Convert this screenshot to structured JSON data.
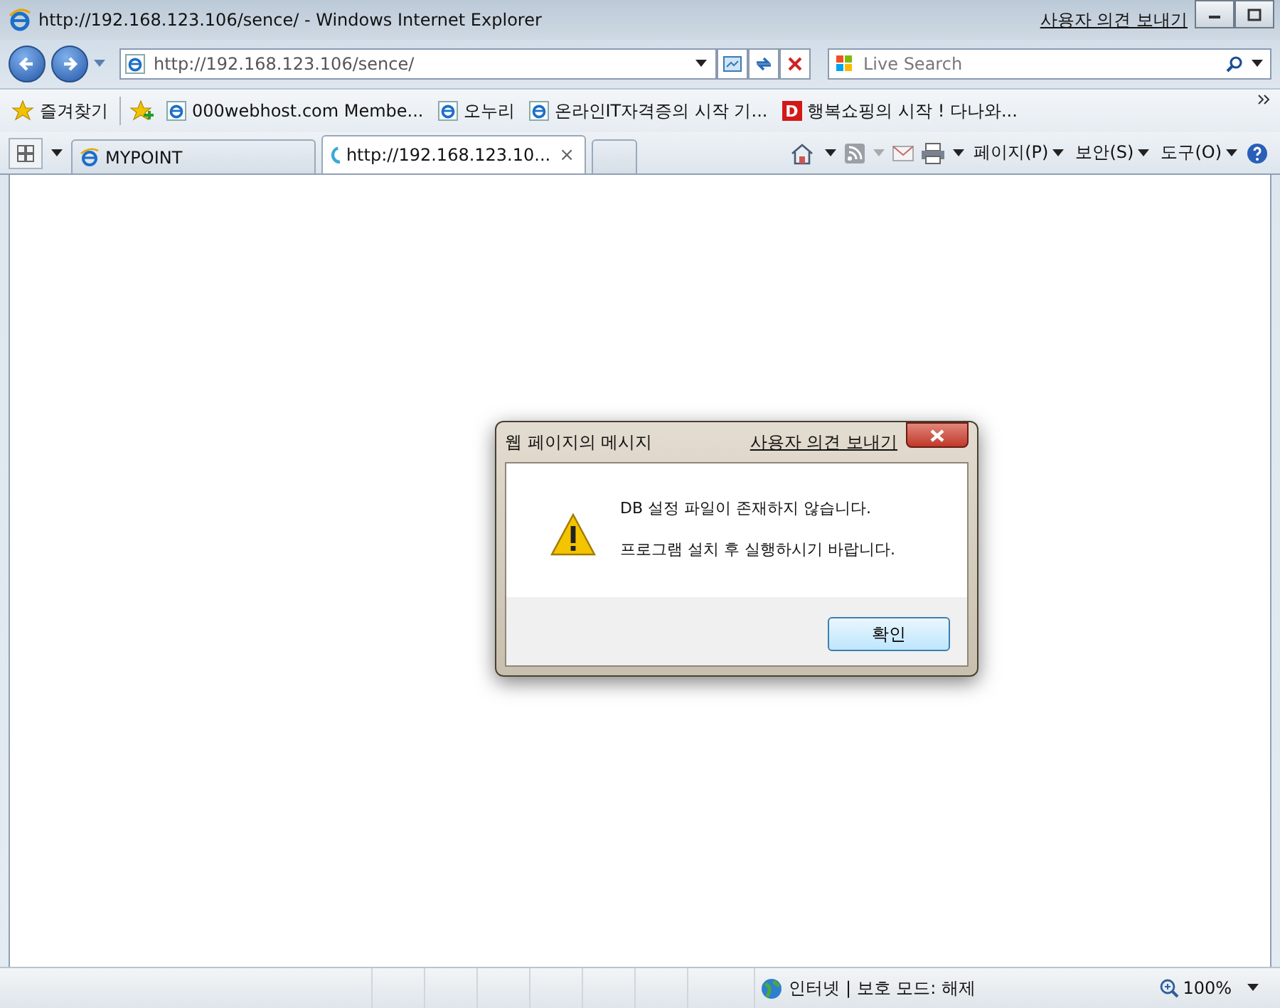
{
  "window": {
    "title": "http://192.168.123.106/sence/ - Windows Internet Explorer",
    "feedback_link": "사용자 의견 보내기"
  },
  "address_bar": {
    "url": "http://192.168.123.106/sence/"
  },
  "search": {
    "placeholder": "Live Search"
  },
  "favorites_bar": {
    "favorites_button": "즐겨찾기",
    "links": [
      {
        "label": "000webhost.com Membe...",
        "kind": "page"
      },
      {
        "label": "오누리",
        "kind": "page"
      },
      {
        "label": "온라인IT자격증의 시작 기...",
        "kind": "page"
      },
      {
        "label": "행복쇼핑의 시작 ! 다나와...",
        "kind": "logo",
        "logo_letter": "D"
      }
    ]
  },
  "tabs": [
    {
      "label": "MYPOINT",
      "selected": false,
      "kind": "page"
    },
    {
      "label": "http://192.168.123.10...",
      "selected": true,
      "kind": "loading",
      "close_glyph": "×"
    }
  ],
  "command_menus": [
    "페이지(P)",
    "보안(S)",
    "도구(O)"
  ],
  "dialog": {
    "title": "웹 페이지의 메시지",
    "feedback_link": "사용자 의견 보내기",
    "messages": [
      "DB 설정 파일이 존재하지 않습니다.",
      "프로그램 설치 후 실행하시기 바랍니다."
    ],
    "button": "확인"
  },
  "status_bar": {
    "zone": "인터넷 | 보호 모드: 해제",
    "zoom": "100%"
  }
}
